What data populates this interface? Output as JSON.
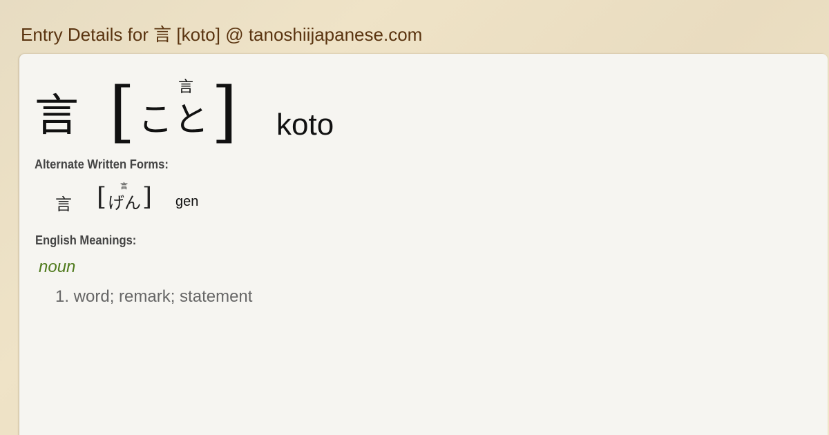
{
  "page": {
    "title": "Entry Details for 言 [koto] @ tanoshiijapanese.com"
  },
  "entry": {
    "kanji": "言",
    "bracket_open": "[",
    "bracket_close": "]",
    "furigana": "言",
    "reading": "こと",
    "romaji": "koto"
  },
  "alternate_forms": {
    "label": "Alternate Written Forms:",
    "items": [
      {
        "kanji": "言",
        "bracket_open": "[",
        "bracket_close": "]",
        "furigana": "言",
        "reading": "げん",
        "romaji": "gen"
      }
    ]
  },
  "meanings": {
    "label": "English Meanings:",
    "part_of_speech": "noun",
    "items": [
      "1. word; remark; statement"
    ]
  },
  "colors": {
    "title": "#5a3410",
    "part_of_speech": "#4f7a1c",
    "meaning_text": "#666666",
    "card_background": "#f6f5f1"
  }
}
